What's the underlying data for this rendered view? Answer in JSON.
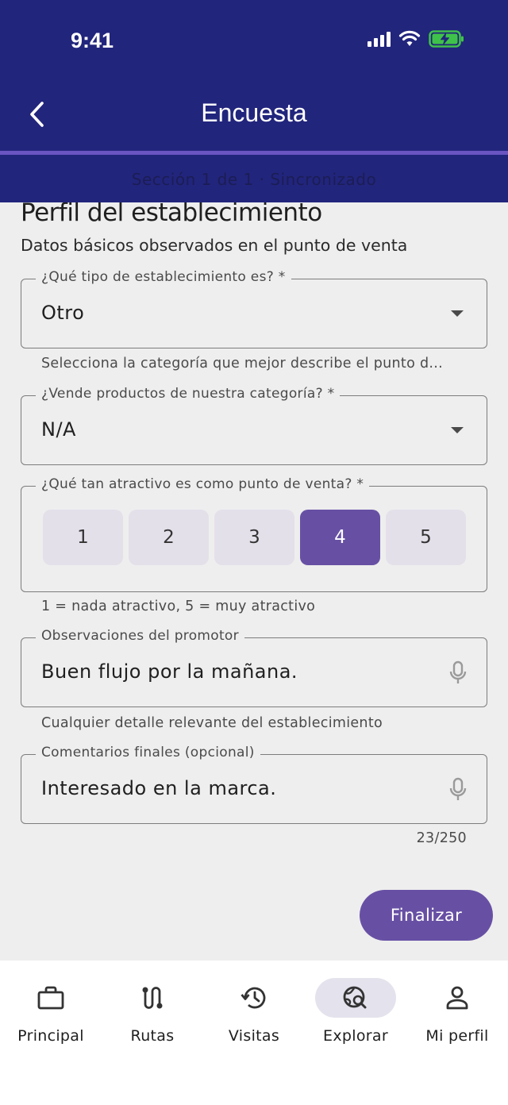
{
  "status_bar": {
    "time": "9:41"
  },
  "header": {
    "title": "Encuesta",
    "section_status": "Sección 1 de 1 · Sincronizado"
  },
  "section": {
    "title": "Perfil del establecimiento",
    "subtitle": "Datos básicos observados en el punto de venta"
  },
  "fields": {
    "establishment_type": {
      "label": "¿Qué tipo de establecimiento es? *",
      "value": "Otro",
      "helper": "Selecciona la categoría que mejor describe el punto d..."
    },
    "sells_category": {
      "label": "¿Vende productos de nuestra categoría? *",
      "value": "N/A"
    },
    "attractiveness": {
      "label": "¿Qué tan atractivo es como punto de venta? *",
      "options": [
        "1",
        "2",
        "3",
        "4",
        "5"
      ],
      "selected": "4",
      "helper": "1 = nada atractivo, 5 = muy atractivo"
    },
    "observations": {
      "label": "Observaciones del promotor",
      "value": "Buen flujo por la mañana.",
      "helper": "Cualquier detalle relevante del establecimiento"
    },
    "final_comments": {
      "label": "Comentarios finales (opcional)",
      "value": "Interesado en la marca.",
      "counter": "23/250"
    }
  },
  "actions": {
    "finalize_label": "Finalizar"
  },
  "bottom_nav": {
    "items": [
      {
        "label": "Principal",
        "icon": "briefcase-icon"
      },
      {
        "label": "Rutas",
        "icon": "route-icon"
      },
      {
        "label": "Visitas",
        "icon": "history-icon"
      },
      {
        "label": "Explorar",
        "icon": "explore-search-icon",
        "active": true
      },
      {
        "label": "Mi perfil",
        "icon": "person-icon"
      }
    ]
  },
  "colors": {
    "header_bg": "#22257c",
    "accent": "#6750a4",
    "progress": "#6a55c2",
    "background": "#eeeeee"
  }
}
